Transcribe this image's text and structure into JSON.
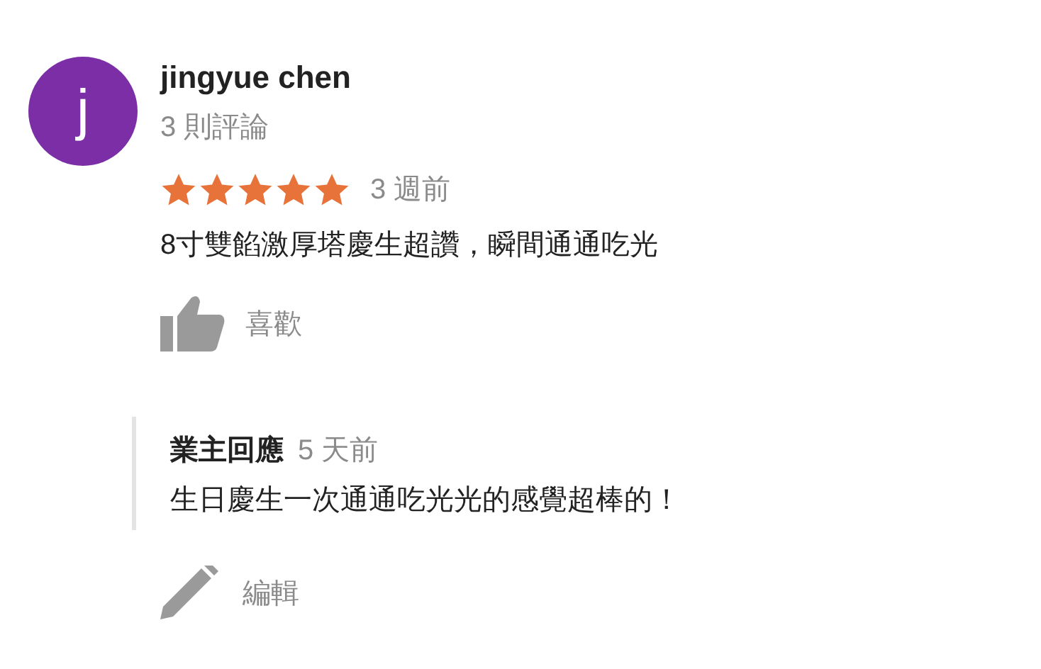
{
  "review": {
    "avatar_letter": "j",
    "color": "#7b2ea6",
    "author": "jingyue chen",
    "review_count": "3 則評論",
    "stars": 5,
    "time": "3 週前",
    "text": "8寸雙餡激厚塔慶生超讚，瞬間通通吃光",
    "like_label": "喜歡"
  },
  "owner_reply": {
    "label": "業主回應",
    "time": "5 天前",
    "text": "生日慶生一次通通吃光光的感覺超棒的！"
  },
  "edit_label": "編輯"
}
